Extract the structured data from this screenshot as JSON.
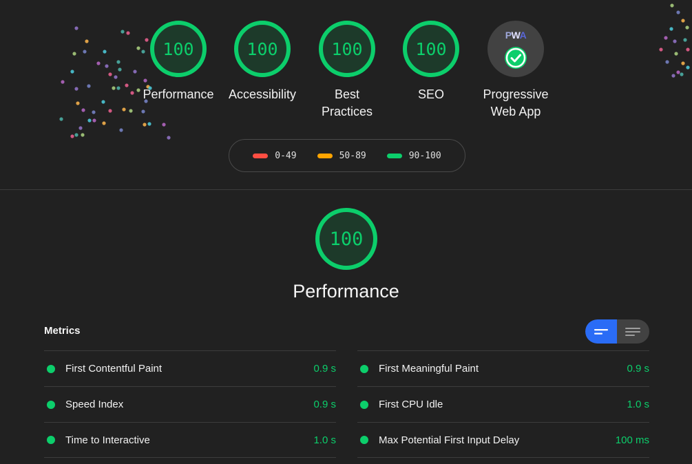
{
  "gauges": [
    {
      "score": "100",
      "label_line1": "Performance",
      "label_line2": ""
    },
    {
      "score": "100",
      "label_line1": "Accessibility",
      "label_line2": ""
    },
    {
      "score": "100",
      "label_line1": "Best",
      "label_line2": "Practices"
    },
    {
      "score": "100",
      "label_line1": "SEO",
      "label_line2": ""
    }
  ],
  "pwa": {
    "badge_p": "P",
    "badge_w": "W",
    "badge_a": "A",
    "label_line1": "Progressive",
    "label_line2": "Web App",
    "icon": "check-icon"
  },
  "legend": {
    "items": [
      {
        "range": "0-49",
        "color": "#ff4e42"
      },
      {
        "range": "50-89",
        "color": "#ffa400"
      },
      {
        "range": "90-100",
        "color": "#0cce6b"
      }
    ]
  },
  "performance": {
    "score": "100",
    "title": "Performance"
  },
  "metrics": {
    "header": "Metrics",
    "left": [
      {
        "name": "First Contentful Paint",
        "value": "0.9 s"
      },
      {
        "name": "Speed Index",
        "value": "0.9 s"
      },
      {
        "name": "Time to Interactive",
        "value": "1.0 s"
      }
    ],
    "right": [
      {
        "name": "First Meaningful Paint",
        "value": "0.9 s"
      },
      {
        "name": "First CPU Idle",
        "value": "1.0 s"
      },
      {
        "name": "Max Potential First Input Delay",
        "value": "100 ms"
      }
    ]
  },
  "colors": {
    "pass": "#0cce6b",
    "toggle_active": "#2a6cf6",
    "background": "#212121"
  }
}
